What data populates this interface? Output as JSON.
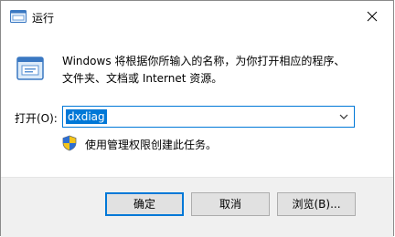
{
  "window": {
    "title": "运行",
    "icon": "run-dialog-icon"
  },
  "description": {
    "line1": "Windows 将根据你所输入的名称，为你打开相应的程序、",
    "line2": "文件夹、文档或 Internet 资源。"
  },
  "open": {
    "label": "打开(O):",
    "value": "dxdiag"
  },
  "admin_note": "使用管理权限创建此任务。",
  "buttons": {
    "ok": "确定",
    "cancel": "取消",
    "browse": "浏览(B)..."
  },
  "colors": {
    "accent": "#0078d7",
    "footer": "#f0f0f0",
    "button": "#e1e1e1"
  }
}
